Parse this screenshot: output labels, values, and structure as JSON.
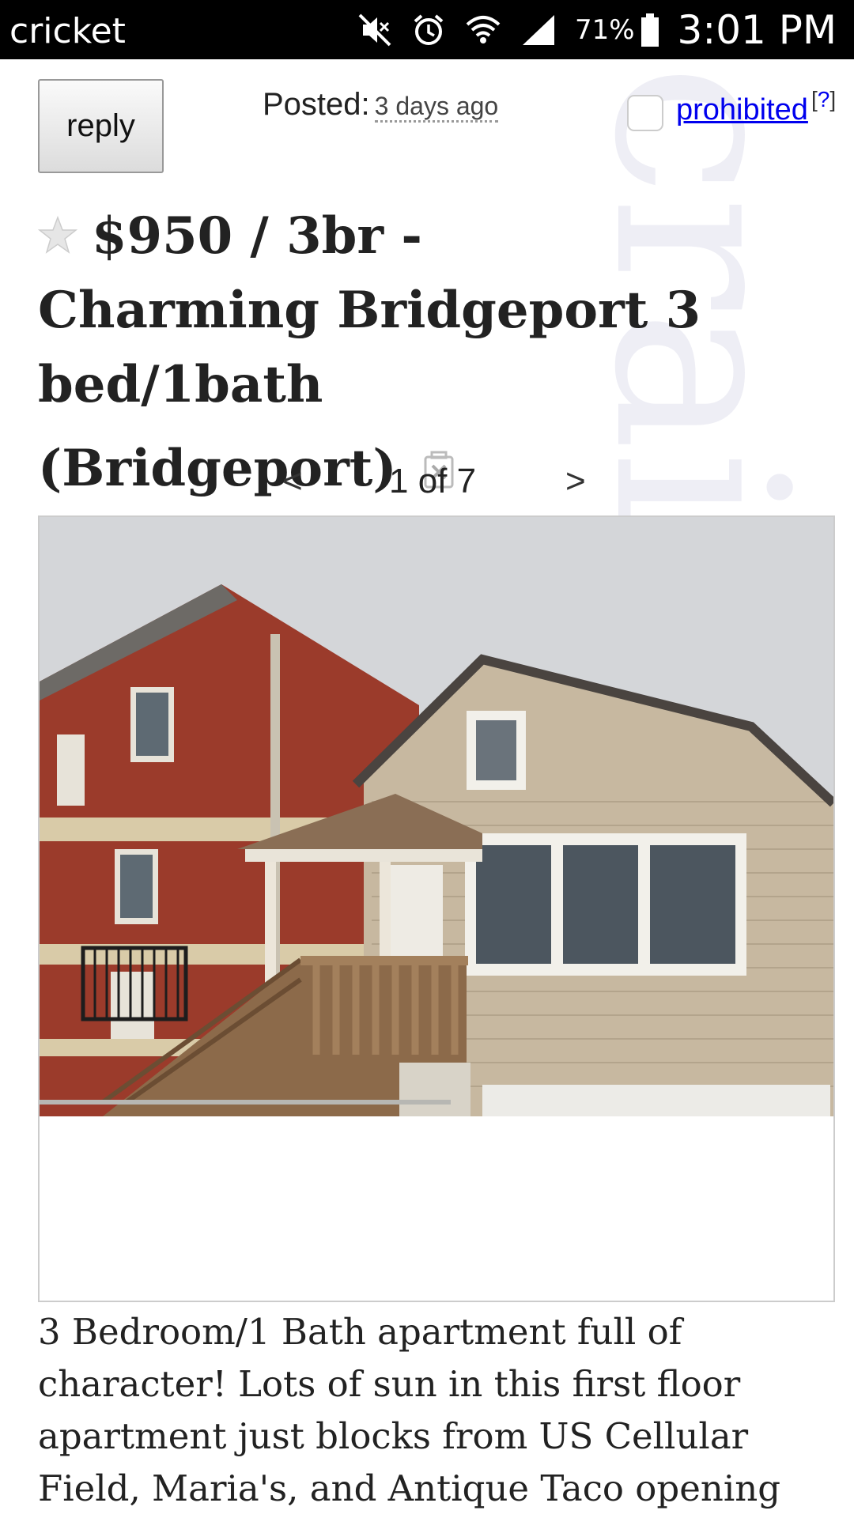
{
  "status_bar": {
    "carrier": "cricket",
    "battery": "71%",
    "time": "3:01 PM"
  },
  "watermark": "craigslist",
  "header": {
    "reply_label": "reply",
    "posted_label": "Posted:",
    "posted_value": "3 days ago",
    "prohibited_label": "prohibited",
    "help_open": "[",
    "help_q": "?",
    "help_close": "]"
  },
  "listing": {
    "title": "$950 / 3br - Charming Bridgeport 3 bed/1bath",
    "neighborhood": "(Bridgeport)"
  },
  "gallery": {
    "prev": "<",
    "counter": "1 of 7",
    "next": ">"
  },
  "body": {
    "text": "3 Bedroom/1 Bath apartment full of character! Lots of sun in this first floor apartment just blocks from US Cellular Field, Maria's, and Antique Taco opening"
  },
  "colors": {
    "link": "#0000ee",
    "text": "#222222",
    "status_bar": "#000000"
  },
  "icons": [
    "mute-icon",
    "alarm-icon",
    "wifi-icon",
    "signal-icon",
    "battery-icon",
    "star-icon",
    "hide-icon"
  ]
}
